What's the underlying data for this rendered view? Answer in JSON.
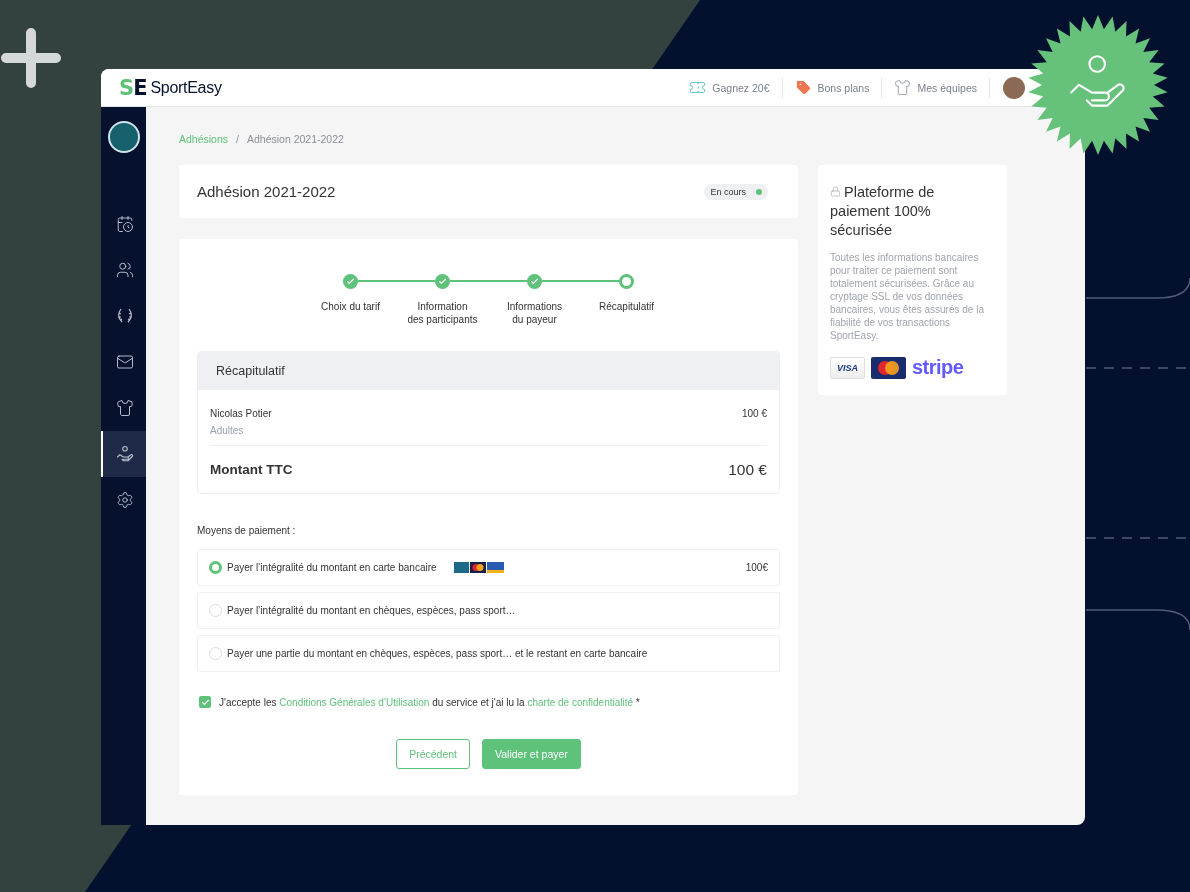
{
  "header": {
    "logo": {
      "mark_left": "S",
      "mark_right": "E",
      "name": "SportEasy"
    },
    "links": [
      {
        "kind": "ticket",
        "label": "Gagnez 20€"
      },
      {
        "kind": "tag",
        "label": "Bons plans"
      },
      {
        "kind": "shirt",
        "label": "Mes équipes"
      }
    ]
  },
  "sidebar": {
    "items": [
      {
        "kind": "calendar",
        "selected": false
      },
      {
        "kind": "people",
        "selected": false
      },
      {
        "kind": "laurel",
        "selected": false
      },
      {
        "kind": "mail",
        "selected": false
      },
      {
        "kind": "shirt",
        "selected": false
      },
      {
        "kind": "hand",
        "selected": true
      },
      {
        "kind": "settings",
        "selected": false
      }
    ]
  },
  "breadcrumb": {
    "parent": "Adhésions",
    "separator": "/",
    "current": "Adhésion 2021-2022"
  },
  "membership": {
    "title": "Adhésion 2021-2022",
    "status": "En cours"
  },
  "steps": [
    {
      "label": "Choix du tarif",
      "done": true
    },
    {
      "label": "Information\ndes participants",
      "done": true
    },
    {
      "label": "Informations\ndu payeur",
      "done": true
    },
    {
      "label": "Récapitulatif",
      "done": false
    }
  ],
  "summary": {
    "title": "Récapitulatif",
    "lines": [
      {
        "name": "Nicolas Potier",
        "category": "Adultes",
        "amount": "100 €"
      }
    ],
    "total_label": "Montant TTC",
    "total": "100 €"
  },
  "payment": {
    "label": "Moyens de paiement :",
    "options": [
      {
        "label": "Payer l’intégralité du montant en carte bancaire",
        "selected": true,
        "cards": true,
        "amount": "100€"
      },
      {
        "label": "Payer l’intégralité du montant en chèques, espèces, pass sport…",
        "selected": false,
        "cards": false
      },
      {
        "label": "Payer une partie du montant en chèques, espèces, pass sport… et le restant en carte bancaire",
        "selected": false,
        "cards": false
      }
    ]
  },
  "terms": {
    "checked": true,
    "before": "J'accepte les ",
    "link_1": "Conditions Générales d’Utilisation",
    "middle": " du service et j'ai lu la ",
    "link_2": "charte de confidentialité",
    "after": " *"
  },
  "buttons": {
    "back": "Précédent",
    "submit": "Valider et payer"
  },
  "security": {
    "title": "Plateforme de paiement 100% sécurisée",
    "text": "Toutes les informations bancaires pour traiter ce paiement sont totalement sécurisées. Grâce au cryptage SSL de vos données bancaires, vous êtes assurés de la fiabilité de vos transactions SportEasy.",
    "visa": "VISA",
    "stripe": "stripe"
  }
}
